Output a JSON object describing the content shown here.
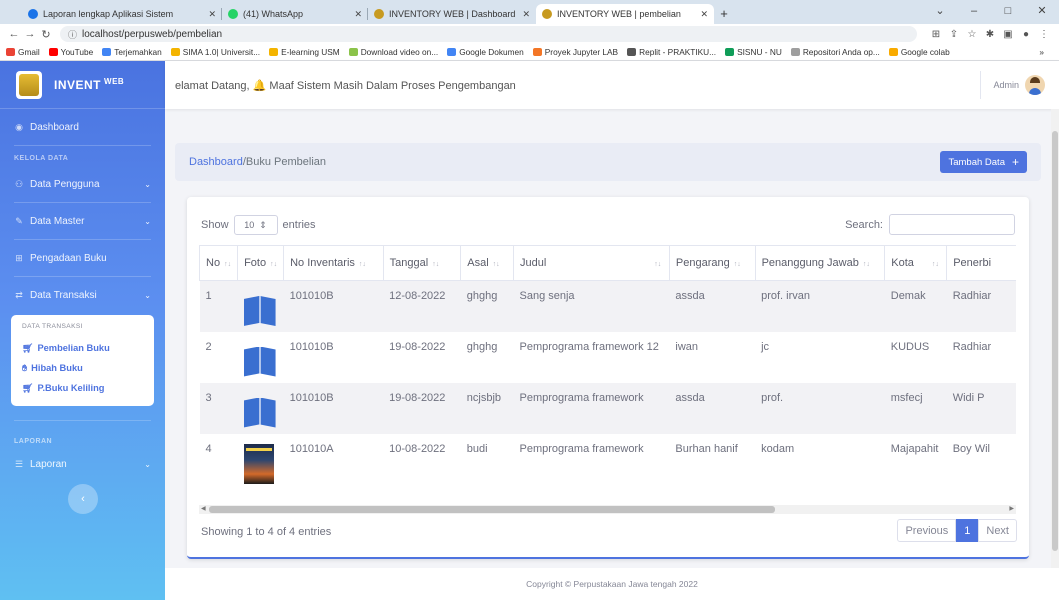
{
  "browser": {
    "tabs": [
      {
        "title": "Laporan lengkap Aplikasi Sistem",
        "color": "#1a73e8"
      },
      {
        "title": "(41) WhatsApp",
        "color": "#25d366"
      },
      {
        "title": "INVENTORY WEB | Dashboard",
        "color": "#c79a20"
      },
      {
        "title": "INVENTORY WEB | pembelian",
        "color": "#c79a20"
      }
    ],
    "url": "localhost/perpusweb/pembelian",
    "bookmarks": [
      {
        "label": "Gmail",
        "color": "#ea4335"
      },
      {
        "label": "YouTube",
        "color": "#ff0000"
      },
      {
        "label": "Terjemahkan",
        "color": "#4285f4"
      },
      {
        "label": "SIMA 1.0| Universit...",
        "color": "#f4b400"
      },
      {
        "label": "E-learning USM",
        "color": "#f4b400"
      },
      {
        "label": "Download video on...",
        "color": "#8bc34a"
      },
      {
        "label": "Google Dokumen",
        "color": "#4285f4"
      },
      {
        "label": "Proyek Jupyter LAB",
        "color": "#f37626"
      },
      {
        "label": "Replit - PRAKTIKU...",
        "color": "#555555"
      },
      {
        "label": "SISNU - NU",
        "color": "#0f9d58"
      },
      {
        "label": "Repositori Anda op...",
        "color": "#9e9e9e"
      },
      {
        "label": "Google colab",
        "color": "#f9ab00"
      }
    ]
  },
  "sidebar": {
    "brand": "INVENT",
    "brand_sup": "WEB",
    "dashboard": "Dashboard",
    "kelola_head": "KELOLA DATA",
    "data_pengguna": "Data Pengguna",
    "data_master": "Data Master",
    "pengadaan": "Pengadaan Buku",
    "data_transaksi": "Data Transaksi",
    "submenu_head": "DATA TRANSAKSI",
    "sub_pembelian": "Pembelian Buku",
    "sub_hibah": "Hibah Buku",
    "sub_keliling": "P.Buku Keliling",
    "laporan_head": "LAPORAN",
    "laporan": "Laporan"
  },
  "topbar": {
    "marquee": "elamat Datang, 🔔 Maaf Sistem Masih Dalam Proses Pengembangan",
    "user": "Admin"
  },
  "breadcrumb": {
    "root": "Dashboard",
    "sep": " / ",
    "current": "Buku Pembelian",
    "add_button": "Tambah Data"
  },
  "table": {
    "show": "Show",
    "length": "10",
    "entries": "entries",
    "search": "Search:",
    "headers": [
      "No",
      "Foto",
      "No Inventaris",
      "Tanggal",
      "Asal",
      "Judul",
      "Pengarang",
      "Penanggung Jawab",
      "Kota",
      "Penerbi"
    ],
    "rows": [
      {
        "no": "1",
        "inv": "101010B",
        "tgl": "12-08-2022",
        "asal": "ghghg",
        "judul": "Sang senja",
        "pengarang": "assda",
        "pj": "prof. irvan",
        "kota": "Demak",
        "penerbit": "Radhiar"
      },
      {
        "no": "2",
        "inv": "101010B",
        "tgl": "19-08-2022",
        "asal": "ghghg",
        "judul": "Pemprograma framework 12",
        "pengarang": "iwan",
        "pj": "jc",
        "kota": "KUDUS",
        "penerbit": "Radhiar"
      },
      {
        "no": "3",
        "inv": "101010B",
        "tgl": "19-08-2022",
        "asal": "ncjsbjb",
        "judul": "Pemprograma framework",
        "pengarang": "assda",
        "pj": "prof.",
        "kota": "msfecj",
        "penerbit": "Widi P"
      },
      {
        "no": "4",
        "inv": "101010A",
        "tgl": "10-08-2022",
        "asal": "budi",
        "judul": "Pemprograma framework",
        "pengarang": "Burhan hanif",
        "pj": "kodam",
        "kota": "Majapahit",
        "penerbit": "Boy Wil"
      }
    ],
    "info": "Showing 1 to 4 of 4 entries",
    "prev": "Previous",
    "page": "1",
    "next": "Next"
  },
  "footer": "Copyright © Perpustakaan Jawa tengah 2022"
}
